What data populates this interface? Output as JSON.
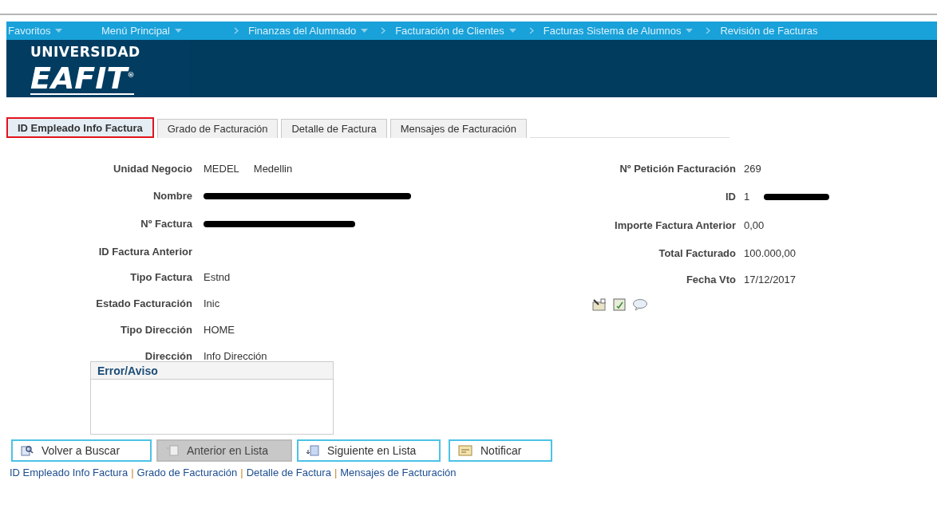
{
  "nav": [
    {
      "label": "Favoritos",
      "dropdown": true,
      "separator": false
    },
    {
      "label": "Menú Principal",
      "dropdown": true,
      "separator": false
    },
    {
      "label": "Finanzas del Alumnado",
      "dropdown": true,
      "separator": true
    },
    {
      "label": "Facturación de Clientes",
      "dropdown": true,
      "separator": true
    },
    {
      "label": "Facturas Sistema de Alumnos",
      "dropdown": true,
      "separator": true
    },
    {
      "label": "Revisión de Facturas",
      "dropdown": false,
      "separator": true
    }
  ],
  "logo": {
    "line1": "UNIVERSIDAD",
    "line2": "EAFIT",
    "mark": "®"
  },
  "tabs": [
    {
      "label": "ID Empleado Info Factura",
      "selected": true
    },
    {
      "label": "Grado de Facturación",
      "selected": false
    },
    {
      "label": "Detalle de Factura",
      "selected": false
    },
    {
      "label": "Mensajes de Facturación",
      "selected": false
    }
  ],
  "left_fields": [
    {
      "label": "Unidad Negocio",
      "values": [
        "MEDEL",
        "Medellin"
      ],
      "redacted": false
    },
    {
      "label": "Nombre",
      "redacted": true
    },
    {
      "label": "Nº Factura",
      "redacted": true
    },
    {
      "label": "ID Factura Anterior",
      "redacted": false
    },
    {
      "label": "Tipo Factura",
      "values": [
        "Estnd"
      ],
      "redacted": false
    },
    {
      "label": "Estado Facturación",
      "values": [
        "Inic"
      ],
      "redacted": false
    },
    {
      "label": "Tipo Dirección",
      "values": [
        "HOME"
      ],
      "redacted": false
    },
    {
      "label": "Dirección",
      "values": [
        "Info Dirección"
      ],
      "redacted": false
    }
  ],
  "right_fields": [
    {
      "label": "Nº Petición Facturación",
      "values": [
        "269"
      ],
      "redacted": false
    },
    {
      "label": "ID",
      "values": [
        "1"
      ],
      "redacted": true
    },
    {
      "label": "Importe Factura Anterior",
      "values": [
        "0,00"
      ],
      "redacted": false
    },
    {
      "label": "Total Facturado",
      "values": [
        "100.000,00"
      ],
      "redacted": false
    },
    {
      "label": "Fecha Vto",
      "values": [
        "17/12/2017"
      ],
      "redacted": false
    }
  ],
  "error_panel": {
    "title": "Error/Aviso"
  },
  "buttons": [
    {
      "label": "Volver a Buscar",
      "kind": "search",
      "disabled": false
    },
    {
      "label": "Anterior en Lista",
      "kind": "previous",
      "disabled": true
    },
    {
      "label": "Siguiente en Lista",
      "kind": "next",
      "disabled": false
    },
    {
      "label": "Notificar",
      "kind": "notify",
      "disabled": false
    }
  ],
  "footer_links": [
    {
      "kind": "link",
      "text": "ID Empleado Info Factura"
    },
    {
      "kind": "separator",
      "text": "|"
    },
    {
      "kind": "link",
      "text": "Grado de Facturación"
    },
    {
      "kind": "separator",
      "text": "|"
    },
    {
      "kind": "link",
      "text": "Detalle de Factura"
    },
    {
      "kind": "separator",
      "text": "|"
    },
    {
      "kind": "link",
      "text": "Mensajes de Facturación"
    }
  ]
}
